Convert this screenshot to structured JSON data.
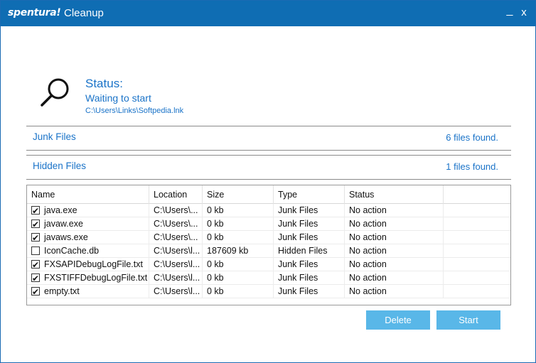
{
  "titlebar": {
    "brand": "spentura!",
    "title": "Cleanup",
    "minimize_label": "_",
    "close_label": "x"
  },
  "status": {
    "label": "Status:",
    "text": "Waiting to start",
    "path": "C:\\Users\\Links\\Softpedia.lnk"
  },
  "sections": {
    "junk": {
      "title": "Junk Files",
      "count": "6 files found."
    },
    "hidden": {
      "title": "Hidden Files",
      "count": "1 files found."
    }
  },
  "table": {
    "columns": [
      "Name",
      "Location",
      "Size",
      "Type",
      "Status"
    ],
    "rows": [
      {
        "checked": true,
        "name": "java.exe",
        "location": "C:\\Users\\...",
        "size": "0 kb",
        "type": "Junk Files",
        "status": "No action"
      },
      {
        "checked": true,
        "name": "javaw.exe",
        "location": "C:\\Users\\...",
        "size": "0 kb",
        "type": "Junk Files",
        "status": "No action"
      },
      {
        "checked": true,
        "name": "javaws.exe",
        "location": "C:\\Users\\...",
        "size": "0 kb",
        "type": "Junk Files",
        "status": "No action"
      },
      {
        "checked": false,
        "name": "IconCache.db",
        "location": "C:\\Users\\l...",
        "size": "187609 kb",
        "type": "Hidden Files",
        "status": "No action"
      },
      {
        "checked": true,
        "name": "FXSAPIDebugLogFile.txt",
        "location": "C:\\Users\\l...",
        "size": "0 kb",
        "type": "Junk Files",
        "status": "No action"
      },
      {
        "checked": true,
        "name": "FXSTIFFDebugLogFile.txt",
        "location": "C:\\Users\\l...",
        "size": "0 kb",
        "type": "Junk Files",
        "status": "No action"
      },
      {
        "checked": true,
        "name": "empty.txt",
        "location": "C:\\Users\\l...",
        "size": "0 kb",
        "type": "Junk Files",
        "status": "No action"
      }
    ]
  },
  "buttons": {
    "delete_label": "Delete",
    "start_label": "Start"
  },
  "colors": {
    "titlebar": "#0f6db3",
    "accent_text": "#1a73c8",
    "button": "#59b7e8"
  },
  "icons": {
    "status": "search-icon"
  }
}
